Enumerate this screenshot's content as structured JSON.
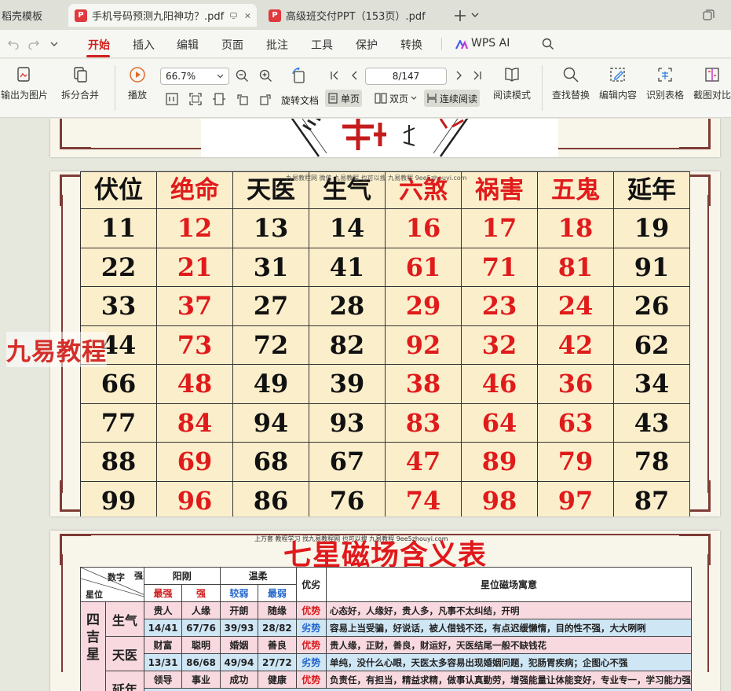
{
  "tabs": [
    {
      "label": "稻壳模板",
      "active": false
    },
    {
      "label": "手机号码预测九阳神功？.pdf",
      "active": true
    },
    {
      "label": "高级班交付PPT（153页）.pdf",
      "active": false
    }
  ],
  "menus": [
    "开始",
    "插入",
    "编辑",
    "页面",
    "批注",
    "工具",
    "保护",
    "转换",
    "WPS AI"
  ],
  "toolbar": {
    "export_image": "输出为图片",
    "split_merge": "拆分合并",
    "play": "播放",
    "zoom": "66.7%",
    "page": "8/147",
    "rotate": "旋转文档",
    "single": "单页",
    "double": "双页",
    "continuous": "连续阅读",
    "read_mode": "阅读模式",
    "find_replace": "查找替换",
    "edit_content": "编辑内容",
    "recognize_table": "识别表格",
    "screenshot_compare": "截图对比"
  },
  "page1": {
    "headers": [
      {
        "text": "伏位",
        "c": "blk"
      },
      {
        "text": "绝命",
        "c": "red"
      },
      {
        "text": "天医",
        "c": "blk"
      },
      {
        "text": "生气",
        "c": "blk"
      },
      {
        "text": "六煞",
        "c": "red"
      },
      {
        "text": "祸害",
        "c": "red"
      },
      {
        "text": "五鬼",
        "c": "red"
      },
      {
        "text": "延年",
        "c": "blk"
      }
    ],
    "rows": [
      [
        "11",
        "12",
        "13",
        "14",
        "16",
        "17",
        "18",
        "19"
      ],
      [
        "22",
        "21",
        "31",
        "41",
        "61",
        "71",
        "81",
        "91"
      ],
      [
        "33",
        "37",
        "27",
        "28",
        "29",
        "23",
        "24",
        "26"
      ],
      [
        "44",
        "73",
        "72",
        "82",
        "92",
        "32",
        "42",
        "62"
      ],
      [
        "66",
        "48",
        "49",
        "39",
        "38",
        "46",
        "36",
        "34"
      ],
      [
        "77",
        "84",
        "94",
        "93",
        "83",
        "64",
        "63",
        "43"
      ],
      [
        "88",
        "69",
        "68",
        "67",
        "47",
        "89",
        "79",
        "78"
      ],
      [
        "99",
        "96",
        "86",
        "76",
        "74",
        "98",
        "97",
        "87"
      ]
    ],
    "watermark": "九易教程网 微信 九易教程 也可以搜 九易教程 9ee5zhouyi.com"
  },
  "overlay_watermark": "九易教程",
  "page2": {
    "title": "七星磁场含义表",
    "watermark": "上万套 教程学习 找九易教程网 也可以搜 九易教程 9ee5zhouyi.com",
    "h_digit": "数字",
    "h_strength": "强弱",
    "h_star": "星位",
    "h_yang": "阳刚",
    "h_wen": "温柔",
    "h_good": "优劣",
    "h_meaning": "星位磁场寓意",
    "h_strongest": "最强",
    "h_strong": "强",
    "h_weak": "较弱",
    "h_weakest": "最弱",
    "group": "四吉星",
    "rows": [
      {
        "star": "生气",
        "w": [
          "贵人",
          "人缘",
          "开朗",
          "随缘"
        ],
        "n": [
          "14/41",
          "67/76",
          "39/93",
          "28/82"
        ],
        "g1": "优势",
        "d1": "心态好，人缘好，贵人多，凡事不太纠结，开明",
        "g2": "劣势",
        "d2": "容易上当受骗，好说话，被人借钱不还，有点迟缓懒惰，目的性不强，大大咧咧"
      },
      {
        "star": "天医",
        "w": [
          "财富",
          "聪明",
          "婚姻",
          "善良"
        ],
        "n": [
          "13/31",
          "86/68",
          "49/94",
          "27/72"
        ],
        "g1": "优势",
        "d1": "贵人缘，正财，善良，财运好，天医结尾一般不缺钱花",
        "g2": "劣势",
        "d2": "单纯，没什么心眼，天医太多容易出现婚姻问题，犯肠胃疾病；企图心不强"
      },
      {
        "star": "延年",
        "w": [
          "领导",
          "事业",
          "成功",
          "健康"
        ],
        "g1": "优势",
        "d1": "负责任，有担当，精益求精，做事认真勤劳，增强能量让体能变好，专业专一，学习能力强"
      }
    ]
  }
}
